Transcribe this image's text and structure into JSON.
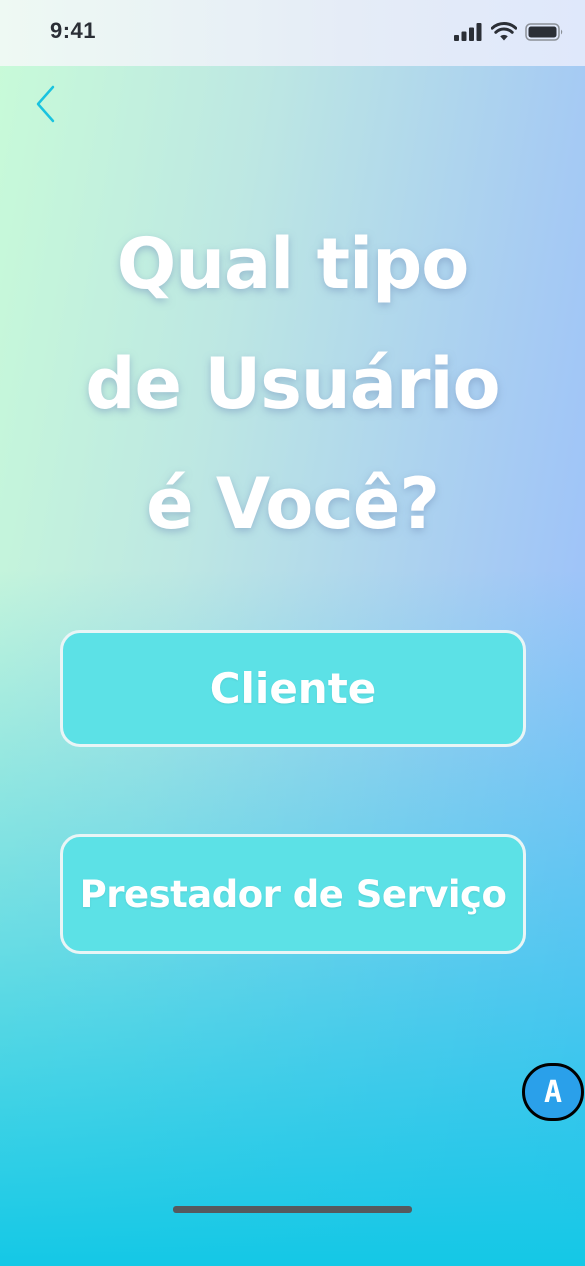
{
  "status_bar": {
    "time": "9:41",
    "icons": [
      "cellular-signal-icon",
      "wifi-icon",
      "battery-icon"
    ]
  },
  "navigation": {
    "back_icon": "chevron-left-icon"
  },
  "title": {
    "line1": "Qual tipo",
    "line2": "de Usuário",
    "line3": "é Você?"
  },
  "options": {
    "cliente_label": "Cliente",
    "prestador_label": "Prestador de Serviço"
  },
  "badge": {
    "label": "A"
  },
  "colors": {
    "button_fill": "#5ce1e6",
    "button_border": "#e9f5f6",
    "back_arrow": "#19c3df",
    "text": "#ffffff"
  }
}
